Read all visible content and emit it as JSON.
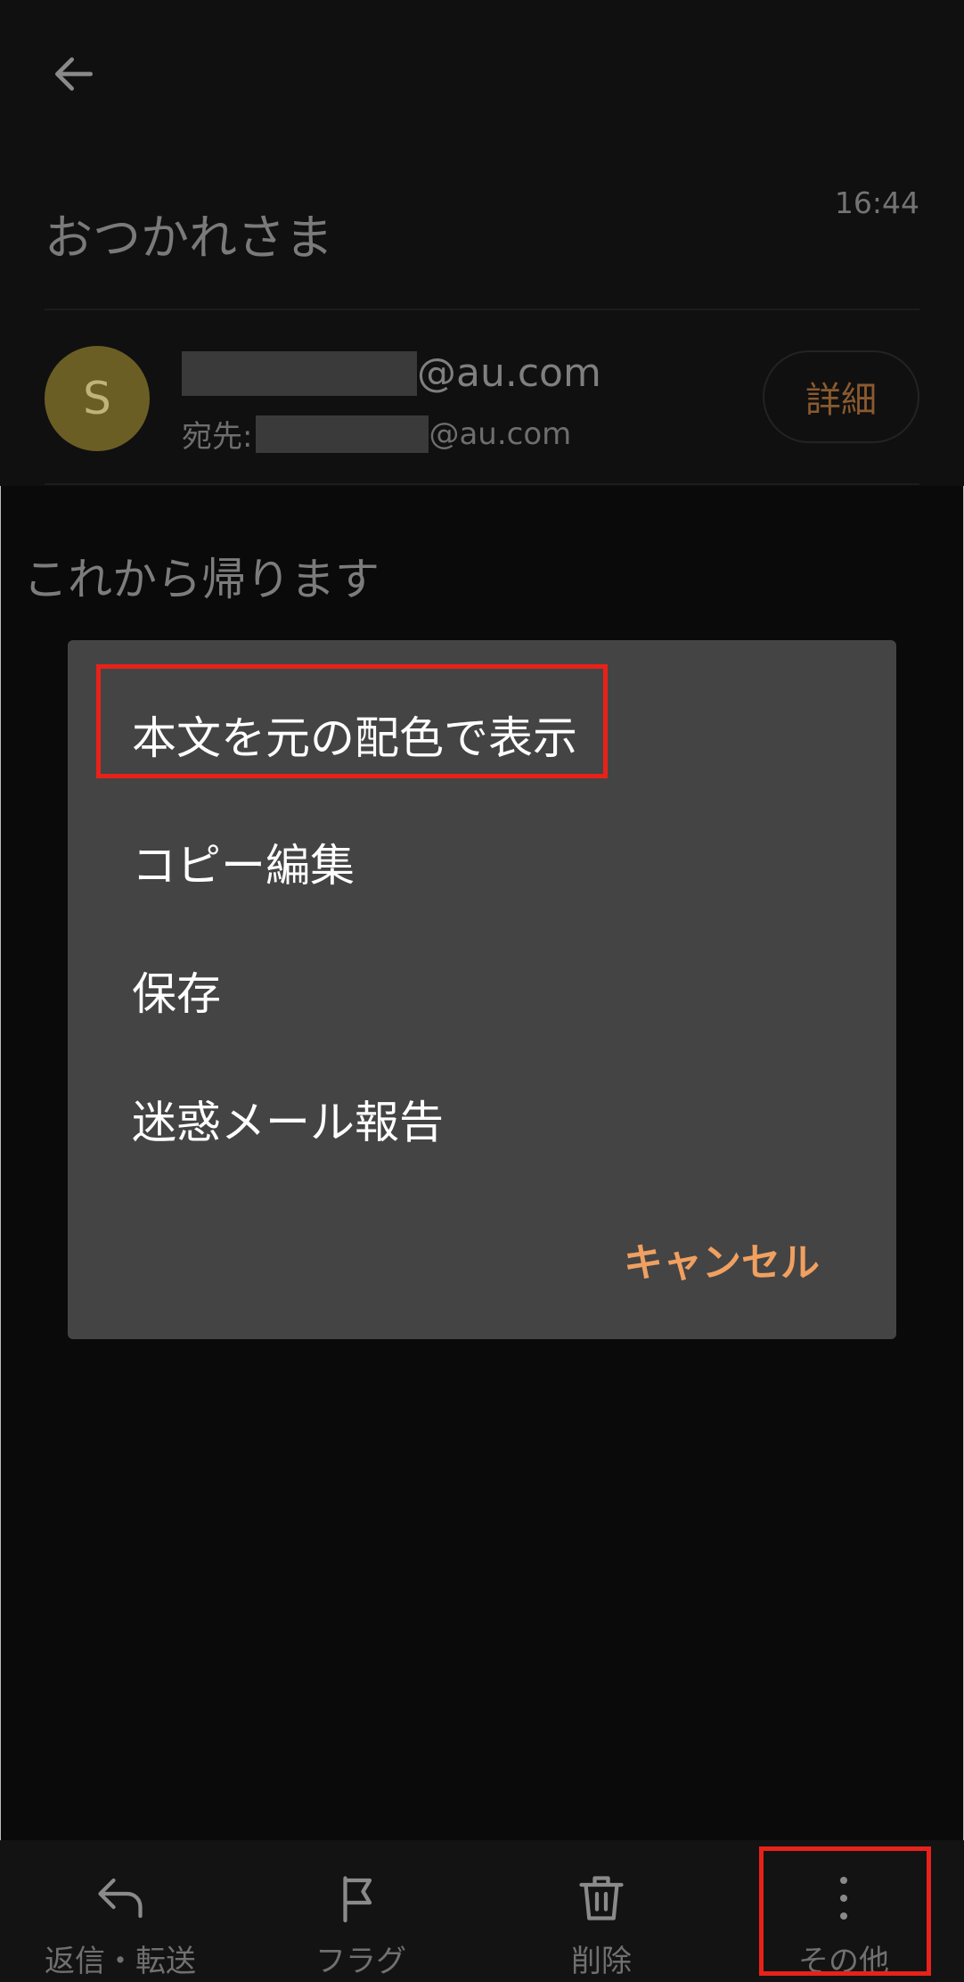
{
  "header": {
    "back_icon": "arrow-left-icon",
    "subject": "おつかれさま",
    "time": "16:44",
    "avatar_letter": "S",
    "from_domain": "@au.com",
    "to_prefix": "宛先:",
    "to_domain": "@au.com",
    "detail_label": "詳細"
  },
  "body": {
    "text": "これから帰ります"
  },
  "dialog": {
    "items": [
      "本文を元の配色で表示",
      "コピー編集",
      "保存",
      "迷惑メール報告"
    ],
    "cancel_label": "キャンセル"
  },
  "bottom_bar": {
    "tabs": [
      {
        "label": "返信・転送",
        "icon": "reply-icon"
      },
      {
        "label": "フラグ",
        "icon": "flag-icon"
      },
      {
        "label": "削除",
        "icon": "trash-icon"
      },
      {
        "label": "その他",
        "icon": "more-vertical-icon"
      }
    ]
  },
  "colors": {
    "highlight": "#e8221a",
    "accent": "#f0a060"
  }
}
